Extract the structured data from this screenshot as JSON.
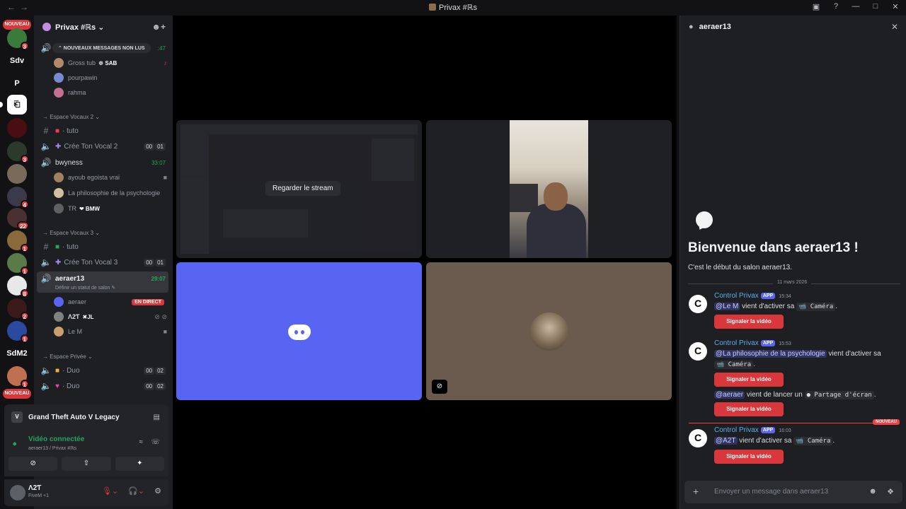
{
  "window": {
    "title": "Privax #ℝs",
    "nav": "←→",
    "btns": [
      "▣",
      "?",
      "—",
      "□",
      "✕"
    ]
  },
  "rail": {
    "badge_new_top": "NOUVEAU",
    "badge_new_bottom": "NOUVEAU",
    "servers": [
      {
        "label": "",
        "badge": "3"
      },
      {
        "label": "Sdv",
        "badge": ""
      },
      {
        "label": "P",
        "badge": ""
      },
      {
        "label": "⎗",
        "badge": ""
      },
      {
        "label": "",
        "badge": ""
      },
      {
        "label": "",
        "badge": "3"
      },
      {
        "label": "",
        "badge": ""
      },
      {
        "label": "",
        "badge": "4"
      },
      {
        "label": "",
        "badge": "22"
      },
      {
        "label": "",
        "badge": "1"
      },
      {
        "label": "",
        "badge": "1"
      },
      {
        "label": "",
        "badge": "8"
      },
      {
        "label": "",
        "badge": "2"
      },
      {
        "label": "",
        "badge": "1"
      },
      {
        "label": "SdM2",
        "badge": ""
      },
      {
        "label": "",
        "badge": "1"
      }
    ]
  },
  "sidebar": {
    "server_name": "Privax #ℝs ⌄",
    "new_messages": "⌃  NOUVEAUX MESSAGES NON LUS",
    "first_time": ":47",
    "users_top": [
      {
        "name": "Gross tub",
        "tag": "☸ SAB"
      },
      {
        "name": "pourpawin",
        "tag": ""
      },
      {
        "name": "rahma",
        "tag": ""
      }
    ],
    "cat1": "→ Espace Vocaux 2 ⌄",
    "ch_tuto1": "· tuto",
    "ch_cree2": "Crée Ton Vocal 2",
    "cnt2a": "00",
    "cnt2b": "01",
    "ch_bwy": "bwyness",
    "bwy_time": "33:07",
    "users_bwy": [
      {
        "name": "ayoub egoista vrai"
      },
      {
        "name": "La philosophie de la psychologie"
      },
      {
        "name": "TR",
        "tag": "❤ BMW"
      }
    ],
    "cat2": "→ Espace Vocaux 3 ⌄",
    "ch_tuto2": "· tuto",
    "ch_cree3": "Crée Ton Vocal 3",
    "cnt3a": "00",
    "cnt3b": "01",
    "ch_aer": "aeraer13",
    "aer_time": "29:07",
    "aer_status": "Définir un statut de salon ✎",
    "users_aer": [
      {
        "name": "aeraer",
        "live": "EN DIRECT"
      },
      {
        "name": "Λ2Ƭ",
        "tag": "✖JL"
      },
      {
        "name": "Le M"
      }
    ],
    "cat3": "→ Espace Privée ⌄",
    "ch_duo1": "· Duo",
    "ch_duo2": "· Duo",
    "duo_a": "00",
    "duo_b": "02"
  },
  "voice": {
    "game": "Grand Theft Auto V Legacy",
    "status": "Vidéo connectée",
    "sub": "aeraer13 / Privax #ℝs",
    "btn_cam": "⊘",
    "btn_share": "⇧",
    "btn_act": "✦"
  },
  "userbar": {
    "name": "Λ2Ƭ",
    "status": "FiveM +1"
  },
  "stage": {
    "watch_stream": "Regarder le stream"
  },
  "chat": {
    "channel": "aeraer13",
    "welcome": "Bienvenue dans aeraer13 !",
    "sub": "C'est le début du salon aeraer13.",
    "date": "11 mars 2026",
    "new_label": "NOUVEAU",
    "bot_name": "Control Privax",
    "app_tag": "APP",
    "btn_label": "Signaler la vidéo",
    "messages": [
      {
        "time": "15:34",
        "mention": "@Le M",
        "text": " vient d'activer sa ",
        "code": "📹 Caméra",
        "end": "."
      },
      {
        "time": "15:53",
        "mention": "@La philosophie de la psychologie",
        "text": " vient d'activer sa",
        "code": "📹 Caméra",
        "end": "."
      },
      {
        "time": "",
        "mention": "@aeraer",
        "text": " vient de lancer un ",
        "code": "● Partage d'écran",
        "end": "."
      },
      {
        "time": "16:03",
        "mention": "@A2T",
        "text": " vient d'activer sa ",
        "code": "📹 Caméra",
        "end": "."
      }
    ],
    "placeholder": "Envoyer un message dans aeraer13"
  }
}
